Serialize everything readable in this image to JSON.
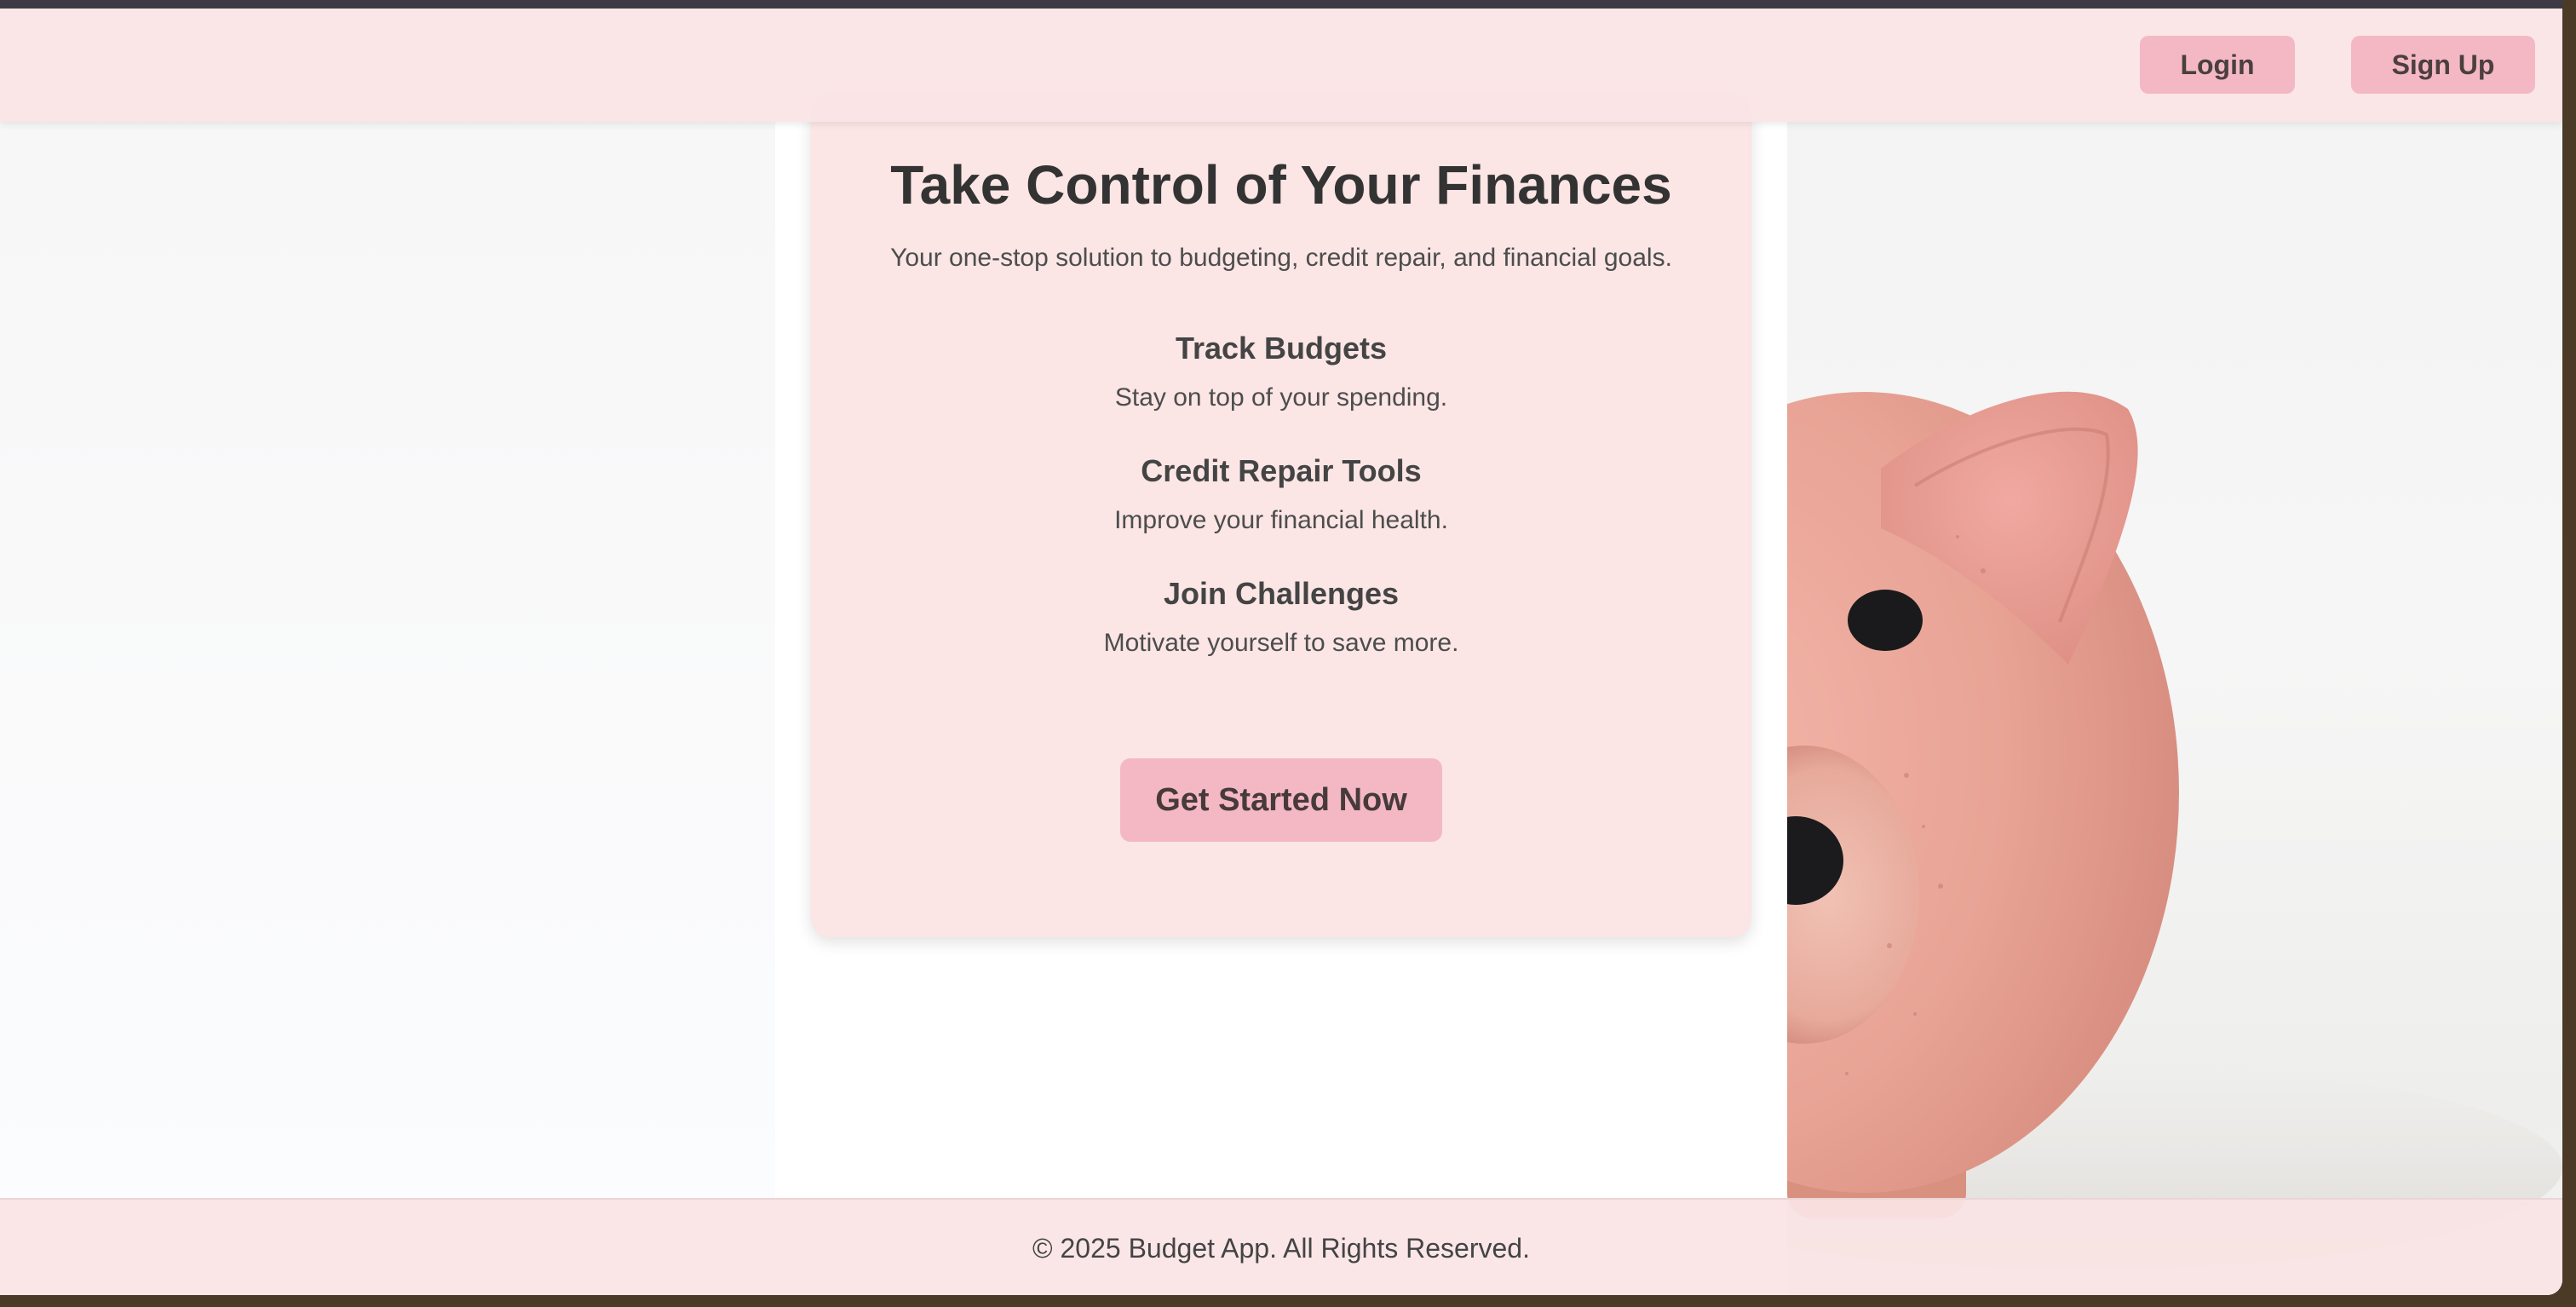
{
  "header": {
    "login_label": "Login",
    "signup_label": "Sign Up"
  },
  "hero": {
    "title": "Take Control of Your Finances",
    "subtitle": "Your one-stop solution to budgeting, credit repair, and financial goals.",
    "features": [
      {
        "title": "Track Budgets",
        "description": "Stay on top of your spending."
      },
      {
        "title": "Credit Repair Tools",
        "description": "Improve your financial health."
      },
      {
        "title": "Join Challenges",
        "description": "Motivate yourself to save more."
      }
    ],
    "cta_label": "Get Started Now"
  },
  "footer": {
    "text": "© 2025 Budget App. All Rights Reserved."
  },
  "background": {
    "image_subject": "piggy-bank",
    "colors": {
      "header_footer": "#fbe5e5",
      "button": "#f4b8c5",
      "pig": "#e8a698"
    }
  }
}
